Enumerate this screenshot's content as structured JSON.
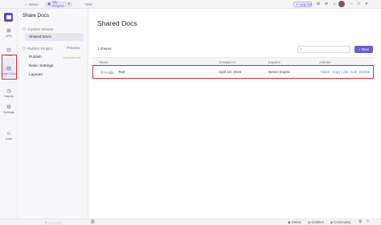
{
  "topbar": {
    "home_label": "Home",
    "project_label": "My Project",
    "test_tab": "Test",
    "upgrade_label": "Upgrade"
  },
  "rail": {
    "items": [
      {
        "label": "APIs"
      },
      {
        "label": "Tests"
      },
      {
        "label": "Share Docs"
      },
      {
        "label": "History"
      },
      {
        "label": "Settings"
      },
      {
        "label": "Invite"
      }
    ]
  },
  "sidebar": {
    "title": "Share Docs",
    "custom_shares": "Custom Shares",
    "shared_docs": "Shared Docs",
    "publish_project": "Publish Project",
    "preview": "Preview",
    "publish": "Publish",
    "publish_note": "Unpublished",
    "basic_settings": "Basic Settings",
    "layouts": "Layouts"
  },
  "main": {
    "title": "Shared Docs",
    "search_placeholder": "",
    "new_button": "New",
    "count": "1 shares",
    "columns": [
      "Name",
      "Created At",
      "Expires",
      "Actions"
    ],
    "row": {
      "status": "Public",
      "name": "Test",
      "created_at": "April 19, 2024",
      "expires": "Never Expire",
      "actions": [
        "Open",
        "Copy Link",
        "Edit",
        "Delete"
      ]
    }
  },
  "footer": {
    "logo_text": "APIDOG",
    "online": "Online",
    "cookies": "Cookies",
    "community": "Community"
  },
  "colors": {
    "accent": "#6a5fcf",
    "highlight": "#d7303e",
    "public_green": "#2f9a4a",
    "link_blue": "#5a7be0"
  }
}
